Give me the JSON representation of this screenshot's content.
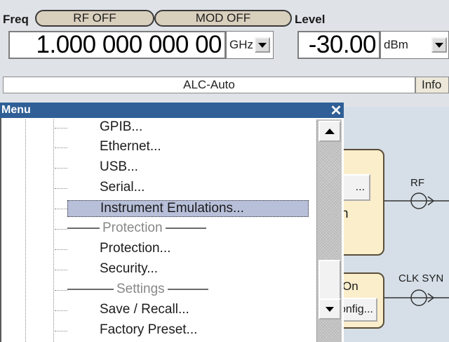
{
  "header": {
    "freq_label": "Freq",
    "rf_off": "RF OFF",
    "mod_off": "MOD OFF",
    "level_label": "Level",
    "freq_value": "1.000 000 000 00",
    "freq_unit": "GHz",
    "level_value": "-30.00",
    "level_unit": "dBm",
    "alc_status": "ALC-Auto",
    "info_button": "Info"
  },
  "menu": {
    "title": "Menu",
    "items": [
      {
        "label": "GPIB...",
        "type": "item"
      },
      {
        "label": "Ethernet...",
        "type": "item"
      },
      {
        "label": "USB...",
        "type": "item"
      },
      {
        "label": "Serial...",
        "type": "item"
      },
      {
        "label": "Instrument Emulations...",
        "type": "item",
        "selected": true
      },
      {
        "label": "Protection",
        "type": "section"
      },
      {
        "label": "Protection...",
        "type": "item"
      },
      {
        "label": "Security...",
        "type": "item"
      },
      {
        "label": "Settings",
        "type": "section"
      },
      {
        "label": "Save / Recall...",
        "type": "item"
      },
      {
        "label": "Factory Preset...",
        "type": "item"
      }
    ]
  },
  "diagram": {
    "rf_label": "RF",
    "clk_label": "CLK SYN",
    "btn_dots": "...",
    "partial_text_n": "n",
    "on_label": "On",
    "config_label": "Config..."
  },
  "colors": {
    "title_bar": "#2f5f96",
    "block_fill": "#fbeecb",
    "selection": "#b7bfd9",
    "pill_fill": "#d9cfbd"
  }
}
